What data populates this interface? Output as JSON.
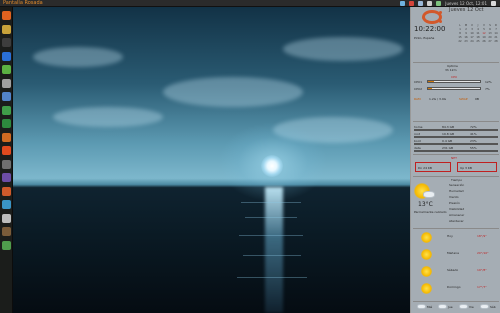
{
  "panel": {
    "app_title": "Pantalla Rosada",
    "clock": "Jueves 12 Oct, 12:01"
  },
  "launcher": {
    "apps": [
      {
        "name": "ubuntu",
        "color": "#e0621f"
      },
      {
        "name": "files",
        "color": "#c8a23a"
      },
      {
        "name": "terminal",
        "color": "#3d3d3d"
      },
      {
        "name": "firefox",
        "color": "#2a6fd6"
      },
      {
        "name": "chrome",
        "color": "#5bb143"
      },
      {
        "name": "settings",
        "color": "#a0a0a0"
      },
      {
        "name": "mail",
        "color": "#5283c9"
      },
      {
        "name": "office",
        "color": "#3f9d49"
      },
      {
        "name": "spreadsheet",
        "color": "#2d8a3e"
      },
      {
        "name": "presentation",
        "color": "#d06b22"
      },
      {
        "name": "software",
        "color": "#e04a1e"
      },
      {
        "name": "calendar",
        "color": "#6f6f6f"
      },
      {
        "name": "chat",
        "color": "#6c4da6"
      },
      {
        "name": "music",
        "color": "#cf5a2b"
      },
      {
        "name": "photos",
        "color": "#3a95c6"
      },
      {
        "name": "text-editor",
        "color": "#bdbdbd"
      },
      {
        "name": "archive",
        "color": "#7a5c3a"
      },
      {
        "name": "trash",
        "color": "#4f9d4d"
      }
    ]
  },
  "conky": {
    "calendar_title": "Jueves 12 Oct",
    "big_time": "10:22:00",
    "location": "Pinto, España",
    "cal_days": [
      "L",
      "M",
      "X",
      "J",
      "V",
      "S",
      "D",
      "1",
      "2",
      "3",
      "4",
      "5",
      "6",
      "7",
      "8",
      "9",
      "10",
      "11",
      "12",
      "13",
      "14",
      "15",
      "16",
      "17",
      "18",
      "19",
      "20",
      "21",
      "22",
      "23",
      "24",
      "25",
      "26",
      "27",
      "28"
    ],
    "uptime_label": "Uptime",
    "uptime_value": "3h 12m",
    "cpu_label": "CPU",
    "cpu1_label": "CPU1",
    "cpu1_value": "12%",
    "cpu2_label": "CPU2",
    "cpu2_value": "7%",
    "ram_label": "RAM",
    "ram_value": "1.2G / 3.9G",
    "swap_label": "SWAP",
    "swap_value": "0B",
    "disk_header": [
      "/home",
      "/",
      "/boot",
      "/data"
    ],
    "disk_rows": [
      [
        "home",
        "84.3 GB",
        "72%"
      ],
      [
        "root",
        "19.8 GB",
        "41%"
      ],
      [
        "boot",
        "0.4 GB",
        "23%"
      ],
      [
        "data",
        "231 GB",
        "55%"
      ]
    ],
    "net_label": "NET",
    "net_down": "Dn 24 KB",
    "net_up": "Up 3 KB",
    "weather_title": "Tiempo",
    "weather_temp": "13°C",
    "weather_desc": "Parcialmente nublado",
    "weather_lines": [
      "Sensación",
      "Humedad",
      "Viento",
      "Presión",
      "Visibilidad",
      "Amanecer",
      "Atardecer"
    ],
    "forecast": [
      "Hoy",
      "Mañana",
      "Sábado",
      "Domingo"
    ],
    "forecast_temps": [
      "18°/9°",
      "20°/10°",
      "19°/8°",
      "17°/7°"
    ],
    "footer_days": [
      "Mié",
      "Jue",
      "Vie",
      "Sáb"
    ]
  },
  "colors": {
    "accent": "#d07a10",
    "warn": "#c02020"
  }
}
